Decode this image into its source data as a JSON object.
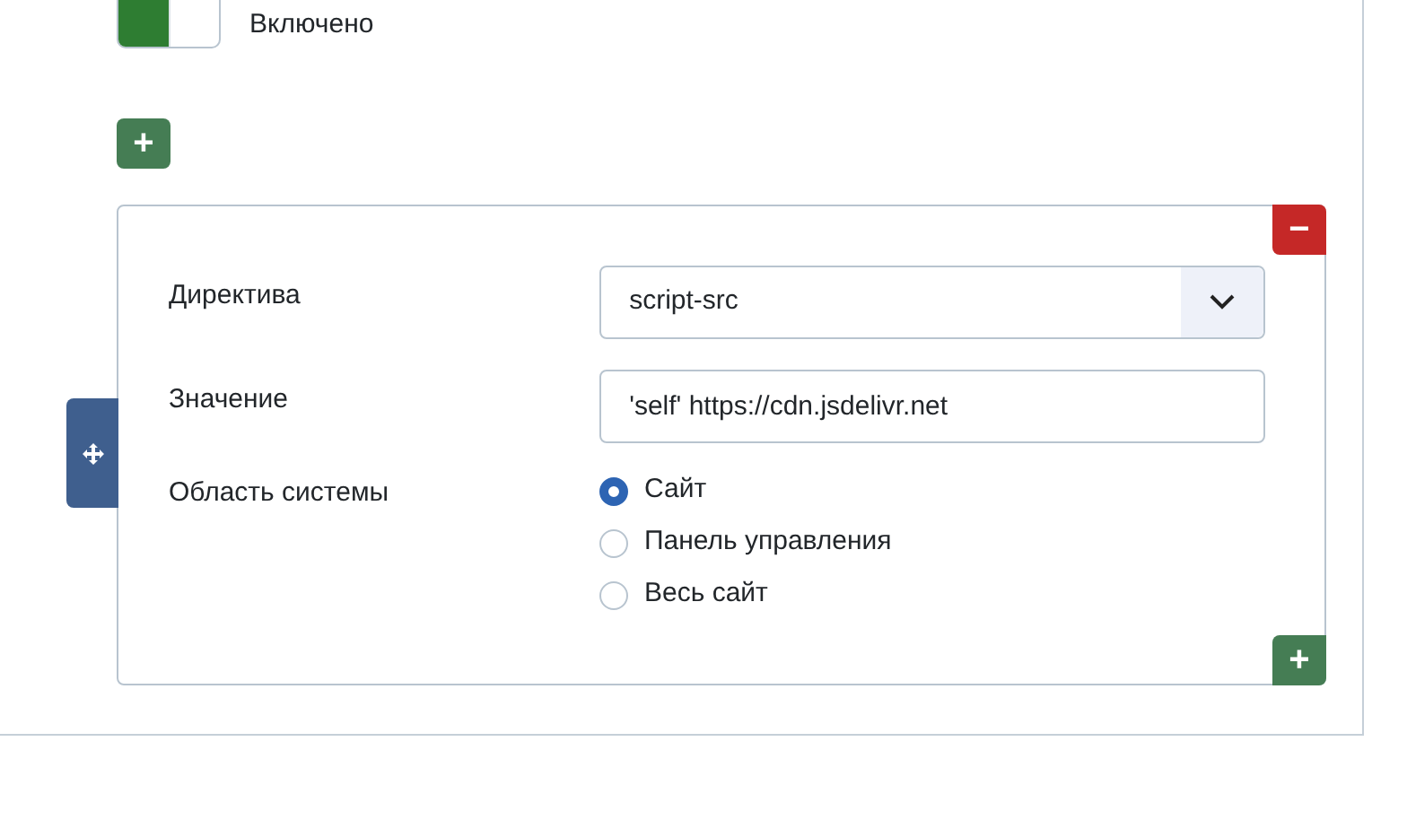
{
  "toggle": {
    "label": "Включено",
    "on": true
  },
  "add_button": {
    "label": "+"
  },
  "rule": {
    "remove_button": {
      "label": "−"
    },
    "fields": [
      {
        "kind": "select",
        "label": "Директива",
        "value": "script-src"
      },
      {
        "kind": "text",
        "label": "Значение",
        "value": "'self' https://cdn.jsdelivr.net"
      },
      {
        "kind": "radio",
        "label": "Область системы",
        "options": [
          {
            "label": "Сайт",
            "selected": true
          },
          {
            "label": "Панель управления",
            "selected": false
          },
          {
            "label": "Весь сайт",
            "selected": false
          }
        ]
      }
    ],
    "add_button": {
      "label": "+"
    }
  }
}
